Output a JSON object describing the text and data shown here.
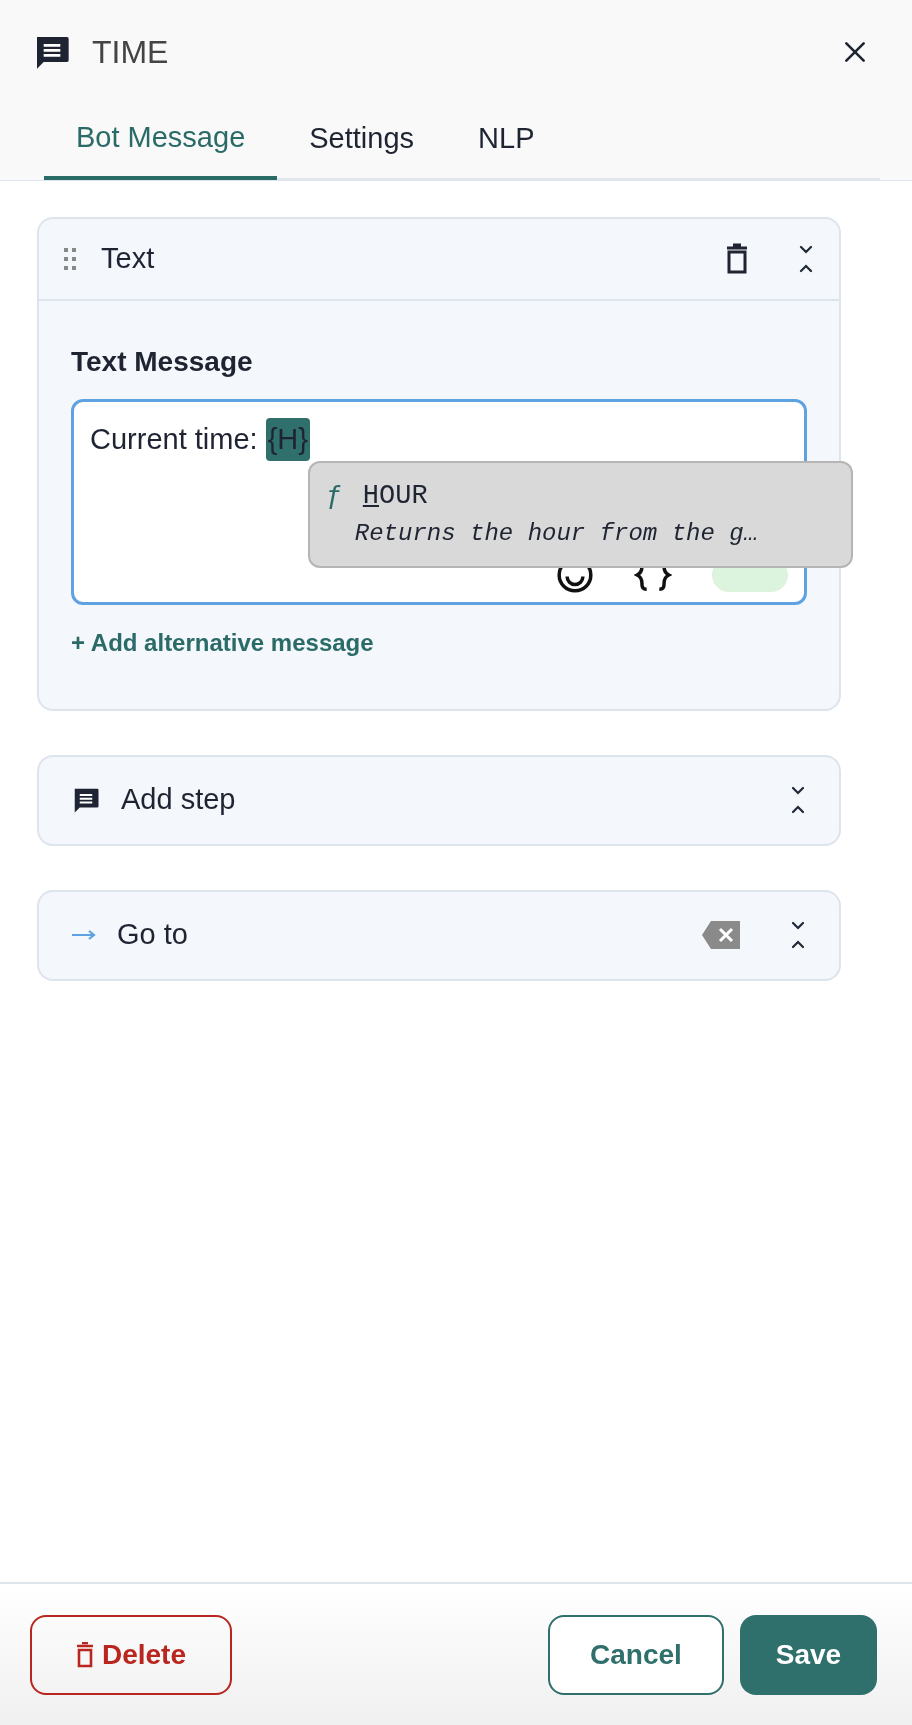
{
  "header": {
    "title": "TIME"
  },
  "tabs": [
    {
      "label": "Bot Message",
      "selected": true
    },
    {
      "label": "Settings",
      "selected": false
    },
    {
      "label": "NLP",
      "selected": false
    }
  ],
  "text_step": {
    "title": "Text",
    "field_label": "Text Message",
    "value_prefix": "Current time: ",
    "token": "{H}",
    "add_link": "+ Add alternative message",
    "suggestion": {
      "glyph": "ƒ",
      "match": "H",
      "rest": "OUR",
      "description": "Returns the hour from the g…"
    }
  },
  "steps": [
    {
      "kind": "add",
      "title": "Add step"
    },
    {
      "kind": "goto",
      "title": "Go to"
    }
  ],
  "footer": {
    "delete": "Delete",
    "cancel": "Cancel",
    "save": "Save"
  }
}
